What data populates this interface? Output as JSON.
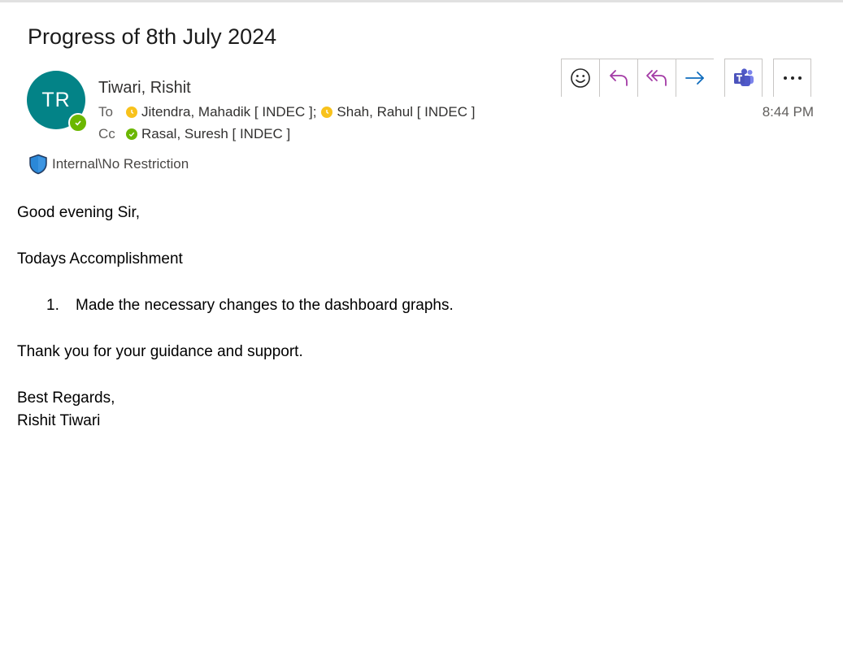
{
  "email": {
    "subject": "Progress of 8th July 2024",
    "sender": {
      "initials": "TR",
      "name": "Tiwari, Rishit",
      "avatar_color": "#038387",
      "presence": "available"
    },
    "to_label": "To",
    "to": [
      {
        "name": "Jitendra, Mahadik [ INDEC ];",
        "status": "away"
      },
      {
        "name": "Shah, Rahul [ INDEC ]",
        "status": "away"
      }
    ],
    "cc_label": "Cc",
    "cc": [
      {
        "name": "Rasal, Suresh [ INDEC ]",
        "status": "available"
      }
    ],
    "sensitivity": "Internal\\No Restriction",
    "time": "8:44 PM",
    "toolbar": [
      {
        "icon": "emoji-icon",
        "name": "reaction-button"
      },
      {
        "icon": "reply-icon",
        "name": "reply-button"
      },
      {
        "icon": "reply-all-icon",
        "name": "reply-all-button"
      },
      {
        "icon": "forward-icon",
        "name": "forward-button"
      },
      {
        "icon": "teams-icon",
        "name": "teams-button"
      },
      {
        "icon": "more-icon",
        "name": "more-actions-button"
      }
    ],
    "body": {
      "greeting": "Good evening Sir,",
      "heading": "Todays Accomplishment",
      "items": [
        {
          "num": "1.",
          "text": "Made the necessary changes to the dashboard graphs."
        }
      ],
      "thanks": "Thank you for your guidance and support.",
      "closing": "Best Regards,",
      "signature": "Rishit Tiwari"
    }
  },
  "colors": {
    "accent_purple": "#a33aa5",
    "forward_blue": "#0f6cbd",
    "away": "#f8c21c",
    "available": "#6bb700"
  }
}
